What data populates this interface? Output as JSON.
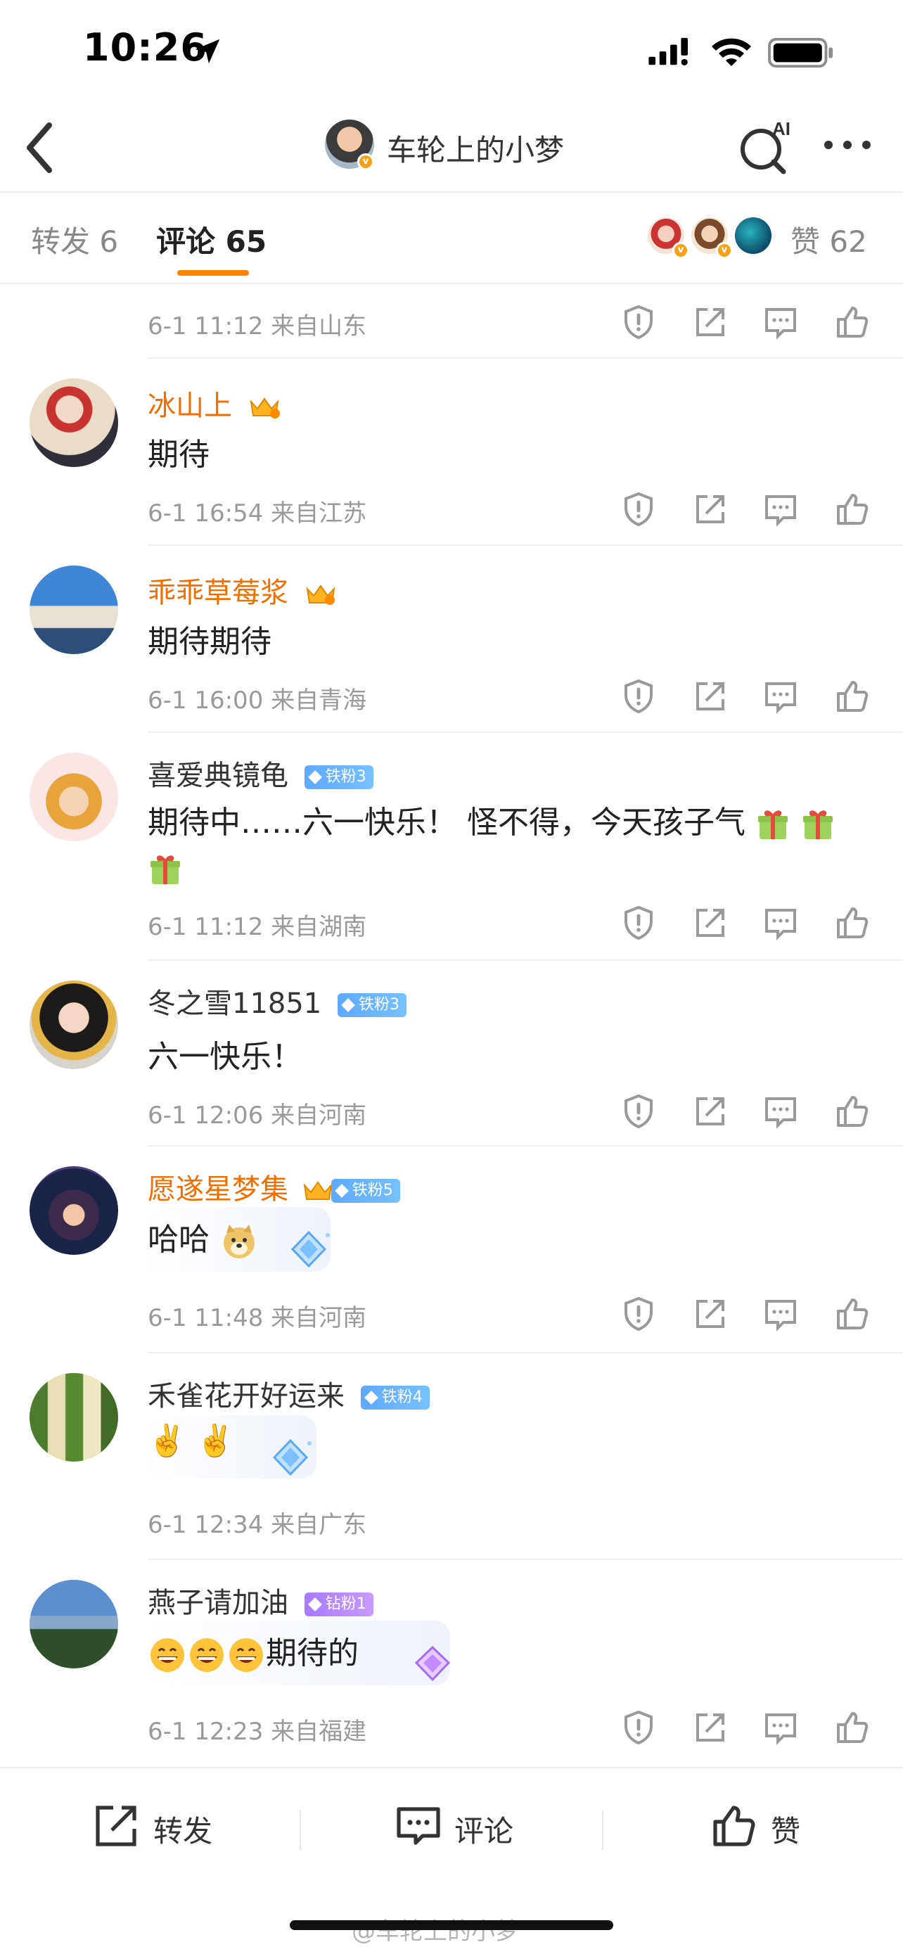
{
  "status_bar": {
    "time": "10:26"
  },
  "nav": {
    "title": "车轮上的小梦",
    "ai_label": "AI"
  },
  "tabs": {
    "repost": "转发 6",
    "comment": "评论 65",
    "likes": "赞 62"
  },
  "comments": [
    {
      "meta": "6-1 11:12  来自山东"
    },
    {
      "name": "冰山上",
      "text": "期待",
      "meta": "6-1 16:54  来自江苏"
    },
    {
      "name": "乖乖草莓浆",
      "text": "期待期待",
      "meta": "6-1 16:00  来自青海"
    },
    {
      "name": "喜爱典镜龟",
      "tag": "铁粉3",
      "text": "期待中……六一快乐！ 怪不得，今天孩子气",
      "meta": "6-1 11:12  来自湖南"
    },
    {
      "name": "冬之雪11851",
      "tag": "铁粉3",
      "text": "六一快乐！",
      "meta": "6-1 12:06  来自河南"
    },
    {
      "name": "愿遂星梦集",
      "tag": "铁粉5",
      "text": "哈哈",
      "meta": "6-1 11:48  来自河南"
    },
    {
      "name": "禾雀花开好运来",
      "tag": "铁粉4",
      "text": "✌️ ✌️",
      "meta": "6-1 12:34  来自广东"
    },
    {
      "name": "燕子请加油",
      "tag": "钻粉1",
      "text": "期待的",
      "meta": "6-1 12:23  来自福建"
    }
  ],
  "bottom_bar": {
    "repost": "转发",
    "comment": "评论",
    "like": "赞"
  },
  "watermark": "@车轮上的小梦",
  "colors": {
    "accent": "#ff8200",
    "vip_name": "#f06f00",
    "fan_tag": "#5ea9ff",
    "diamond_tag": "#a77bff"
  }
}
